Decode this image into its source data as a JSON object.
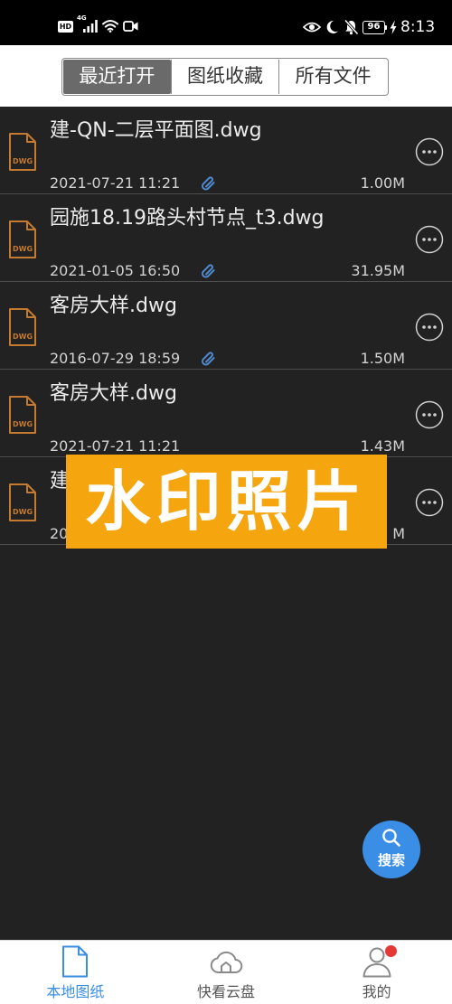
{
  "status_bar": {
    "hd_label": "HD",
    "network_label": "4G",
    "battery_level": "96",
    "time": "8:13",
    "left_icons": [
      "hd-icon",
      "signal-icon",
      "wifi-icon",
      "video-camera-icon"
    ],
    "right_icons": [
      "eye-icon",
      "moon-icon",
      "bell-slash-icon",
      "battery-icon",
      "charging-bolt-icon"
    ]
  },
  "tabs": [
    {
      "label": "最近打开",
      "selected": true
    },
    {
      "label": "图纸收藏",
      "selected": false
    },
    {
      "label": "所有文件",
      "selected": false
    }
  ],
  "file_list": {
    "file_icon": "dwg-file-icon",
    "attachment_icon": "paperclip-icon",
    "row_action_icon": "more-horizontal-icon"
  },
  "files": [
    {
      "name": "建-QN-二层平面图.dwg",
      "type_label": "DWG",
      "modified": "2021-07-21 11:21",
      "size": "1.00M",
      "has_attachment": true
    },
    {
      "name": "园施18.19路头村节点_t3.dwg",
      "type_label": "DWG",
      "modified": "2021-01-05 16:50",
      "size": "31.95M",
      "has_attachment": true
    },
    {
      "name": "客房大样.dwg",
      "type_label": "DWG",
      "modified": "2016-07-29 18:59",
      "size": "1.50M",
      "has_attachment": true
    },
    {
      "name": "客房大样.dwg",
      "type_label": "DWG",
      "modified": "2021-07-21 11:21",
      "size": "1.43M",
      "has_attachment": false
    },
    {
      "name": "建",
      "type_label": "DWG",
      "modified": "20",
      "size": "M"
    }
  ],
  "watermark": {
    "text": "水印照片"
  },
  "search_fab": {
    "label": "搜索",
    "icon": "search-icon"
  },
  "bottom_nav": [
    {
      "label": "本地图纸",
      "icon": "document-icon",
      "active": true
    },
    {
      "label": "快看云盘",
      "icon": "cloud-icon",
      "active": false
    },
    {
      "label": "我的",
      "icon": "person-icon",
      "active": false,
      "badge": true
    }
  ],
  "colors": {
    "accent": "#3A8EE6",
    "watermark": "#F5A50E",
    "file_icon": "#C47A30",
    "attachment": "#4F8AD0",
    "badge": "#E53935",
    "tab_selected": "#6A6A6A"
  }
}
